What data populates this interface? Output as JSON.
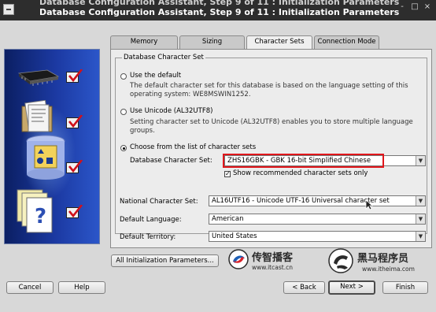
{
  "window": {
    "title": "Database Configuration Assistant, Step 9 of 11 : Initialization Parameters",
    "ghost_title": "Database Configuration Assistant, Step 9 of 11 : Initialization Parameters",
    "controls": [
      "-",
      "□",
      "×"
    ]
  },
  "tabs": [
    {
      "label": "Memory",
      "active": false
    },
    {
      "label": "Sizing",
      "active": false
    },
    {
      "label": "Character Sets",
      "active": true
    },
    {
      "label": "Connection Mode",
      "active": false
    }
  ],
  "charset_group": {
    "legend": "Database Character Set",
    "option_default": {
      "label": "Use the default",
      "description": "The default character set for this database is based on the language setting of this operating system: WE8MSWIN1252.",
      "selected": false
    },
    "option_unicode": {
      "label": "Use Unicode (AL32UTF8)",
      "description": "Setting character set to Unicode (AL32UTF8) enables you to store multiple language groups.",
      "selected": false
    },
    "option_choose": {
      "label": "Choose from the list of character sets",
      "selected": true
    },
    "db_charset": {
      "label": "Database Character Set:",
      "value": "ZHS16GBK - GBK 16-bit Simplified Chinese"
    },
    "show_recommended": {
      "label": "Show recommended character sets only",
      "checked": true
    }
  },
  "national_charset": {
    "label": "National Character Set:",
    "value": "AL16UTF16 - Unicode UTF-16 Universal character set"
  },
  "default_language": {
    "label": "Default Language:",
    "value": "American"
  },
  "default_territory": {
    "label": "Default Territory:",
    "value": "United States"
  },
  "buttons": {
    "all_params": "All Initialization Parameters...",
    "cancel": "Cancel",
    "help": "Help",
    "back": "< Back",
    "next": "Next",
    "next_arrow": ">",
    "finish": "Finish"
  },
  "watermarks": {
    "left_brand": "传智播客",
    "left_url": "www.itcast.cn",
    "right_brand": "黑马程序员",
    "right_url": "www.itheima.com"
  },
  "colors": {
    "highlight_box": "#e0161b",
    "rail_blue": "#1c3aa3",
    "titlebar": "#2d2d2d"
  },
  "icons": [
    "window-menu-icon",
    "chip-icon",
    "folder-documents-icon",
    "database-shapes-icon",
    "help-documents-icon",
    "checkmark-icon",
    "itcast-logo-icon",
    "itheima-logo-icon",
    "mouse-cursor-icon"
  ]
}
